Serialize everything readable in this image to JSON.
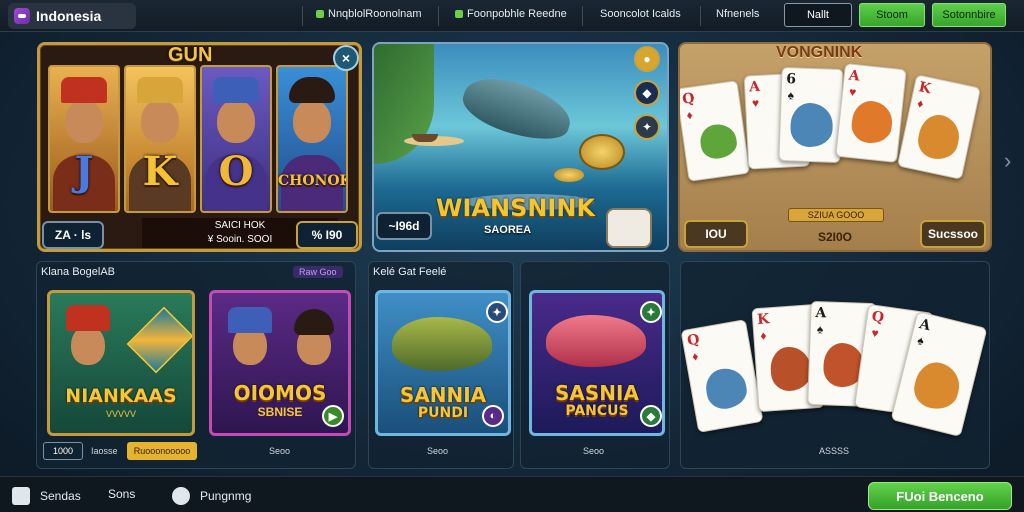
{
  "header": {
    "brand": "Indonesia",
    "links": [
      "Nnqblol​Roonolnam",
      "Foonpobhle Reedne",
      "Sooncolot Icalds",
      "Nfnenels"
    ],
    "login_label": "Nallt",
    "signup_label": "Stoom",
    "extra_label": "Sotonnbire"
  },
  "featured": {
    "slot": {
      "title": "GUN",
      "reels": [
        "J",
        "K",
        "O",
        "CHONOK"
      ],
      "close_icon": "close-icon",
      "left_pill": "ZA · ls",
      "center_line1": "SAICI HOK",
      "center_line2": "¥ Sooin. SOOI",
      "right_pill": "% I90"
    },
    "fishing": {
      "title": "WIANSNINK",
      "subtitle": "SAOREA",
      "left_pill": "~I96d",
      "icons": [
        "coin-icon",
        "shield-icon",
        "compass-icon"
      ]
    },
    "cards": {
      "title": "VONGNINK",
      "left_pill": "IOU",
      "center_label": "S2I0O",
      "ribbon": "SZIUA GOOO",
      "right_pill": "Sucssoo",
      "cards": [
        {
          "rank": "Q",
          "suit": "♦"
        },
        {
          "rank": "A",
          "suit": "♥"
        },
        {
          "rank": "6",
          "suit": "♠"
        },
        {
          "rank": "A",
          "suit": "♥"
        },
        {
          "rank": "K",
          "suit": "♦"
        }
      ]
    }
  },
  "sections": {
    "left": {
      "title": "Klana BogelAB",
      "tag": "Raw Goo",
      "tiles": [
        {
          "title": "NIANKAAS",
          "subtitle": "VVVVV"
        },
        {
          "title": "OIOMOS",
          "subtitle": "SBNISE"
        }
      ],
      "meta": [
        "1000",
        "Iaosse",
        "Ruooonooooo",
        "Seoo"
      ]
    },
    "middle": {
      "title": "Kelé Gat Feelé",
      "tiles": [
        {
          "title": "SANNIA",
          "subtitle": "PUNDI"
        },
        {
          "title": "SASNIA",
          "subtitle": "PANCUS"
        }
      ],
      "meta": [
        "Seoo",
        "Seoo"
      ]
    },
    "right": {
      "meta": "ASSSS",
      "cards": [
        {
          "rank": "Q",
          "suit": "♦"
        },
        {
          "rank": "K",
          "suit": "♦"
        },
        {
          "rank": "A",
          "suit": "♠"
        },
        {
          "rank": "Q",
          "suit": "♥"
        },
        {
          "rank": "A",
          "suit": "♠"
        }
      ]
    }
  },
  "footer": {
    "items": [
      "Sendas",
      "Sons",
      "Pungnmg"
    ],
    "cta": "FUoi Benceno"
  },
  "colors": {
    "accent_green": "#5fce4a",
    "gold": "#c59a3c",
    "title_gold": "#f3c52f"
  }
}
